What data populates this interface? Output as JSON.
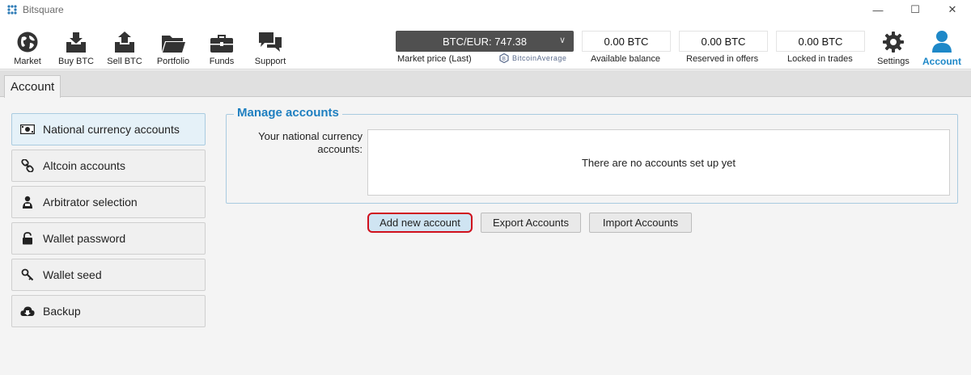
{
  "window": {
    "title": "Bitsquare",
    "controls": [
      "—",
      "☐",
      "✕"
    ]
  },
  "nav": [
    {
      "label": "Market",
      "icon": "globe-icon"
    },
    {
      "label": "Buy BTC",
      "icon": "buy-btc-icon"
    },
    {
      "label": "Sell BTC",
      "icon": "sell-btc-icon"
    },
    {
      "label": "Portfolio",
      "icon": "folder-icon"
    },
    {
      "label": "Funds",
      "icon": "briefcase-icon"
    },
    {
      "label": "Support",
      "icon": "chat-icon"
    }
  ],
  "market_price": {
    "value": "BTC/EUR: 747.38",
    "label": "Market price (Last)",
    "provider": "BitcoinAverage"
  },
  "balances": [
    {
      "value": "0.00 BTC",
      "label": "Available balance"
    },
    {
      "value": "0.00 BTC",
      "label": "Reserved in offers"
    },
    {
      "value": "0.00 BTC",
      "label": "Locked in trades"
    }
  ],
  "settings": {
    "label": "Settings"
  },
  "account": {
    "label": "Account"
  },
  "tabs": [
    {
      "label": "Account"
    }
  ],
  "menu": [
    {
      "label": "National currency accounts",
      "icon": "banknote-icon",
      "active": true
    },
    {
      "label": "Altcoin accounts",
      "icon": "link-icon",
      "active": false
    },
    {
      "label": "Arbitrator selection",
      "icon": "arbitrator-icon",
      "active": false
    },
    {
      "label": "Wallet password",
      "icon": "lock-icon",
      "active": false
    },
    {
      "label": "Wallet seed",
      "icon": "key-icon",
      "active": false
    },
    {
      "label": "Backup",
      "icon": "cloud-download-icon",
      "active": false
    }
  ],
  "manage": {
    "title": "Manage accounts",
    "field_label": "Your national currency accounts:",
    "empty_text": "There are no accounts set up yet",
    "buttons": {
      "add": "Add new account",
      "export": "Export Accounts",
      "import": "Import Accounts"
    }
  },
  "colors": {
    "accent": "#1e88c8",
    "highlight": "#d0101c"
  }
}
